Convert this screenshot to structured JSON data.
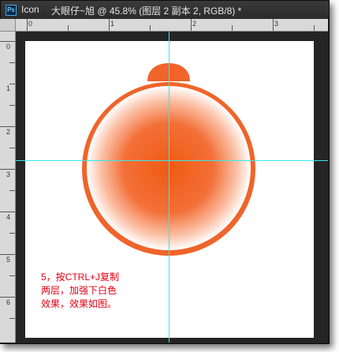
{
  "titlebar": {
    "app_badge": "Ps",
    "app_name": "Icon",
    "document_title": "大眼仔~旭 @ 45.8% (图层 2 副本 2, RGB/8) *"
  },
  "ruler": {
    "top_labels": [
      "0",
      "1",
      "2",
      "3",
      "4",
      "5",
      "6"
    ],
    "left_labels": [
      "0",
      "1",
      "2",
      "3",
      "4",
      "5",
      "6"
    ]
  },
  "canvas": {
    "background_color": "#ffffff",
    "icon_color": "#f0642a",
    "glow_color": "#ffffff",
    "guide_color": "#39e6e6"
  },
  "caption": {
    "lines": [
      "5，按CTRL+J复制",
      "两层，加强下白色",
      "效果，效果如图。"
    ],
    "color": "#e60012"
  }
}
